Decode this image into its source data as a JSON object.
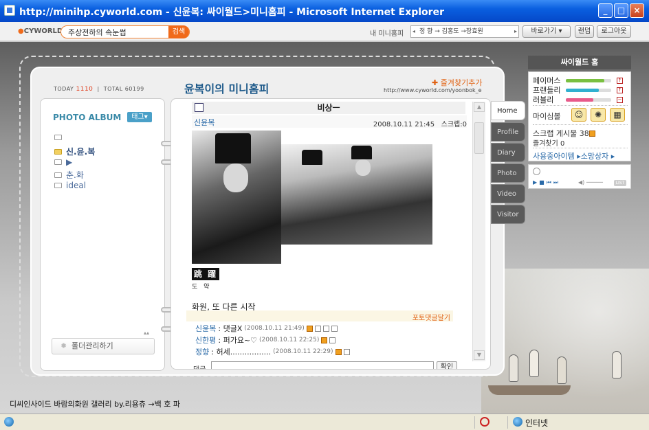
{
  "window": {
    "title": "http://minihp.cyworld.com - 신윤복: 싸이월드>미니홈피 - Microsoft Internet Explorer",
    "buttons": [
      "_",
      "□",
      "×"
    ]
  },
  "toolbar": {
    "logo": "CYWORLD",
    "search_value": "주상전하의 속눈썹",
    "search_button": "검색",
    "my_minihompy": "내 미니홈피",
    "path_text": "정 향 → 김홍도 →장효원",
    "goto": "바로가기",
    "random": "랜덤",
    "logout": "로그아웃"
  },
  "header": {
    "today_label": "TODAY",
    "today_value": "1110",
    "total_label": "TOTAL",
    "total_value": "60199",
    "title": "윤복이의 미니홈피",
    "favorite": "즐겨찾기추가",
    "url": "http://www.cyworld.com/yoonbok_e"
  },
  "album": {
    "title": "PHOTO ALBUM",
    "tag_button": "태그",
    "folders": [
      "",
      "신.윤.복",
      "▶",
      "춘.화",
      "ideal"
    ],
    "manage": "폴더관리하기"
  },
  "post": {
    "title": "비상ㅡ",
    "author": "신윤복",
    "date": "2008.10.11 21:45",
    "scrap": "스크랩:0",
    "stamp": "跳 躍",
    "stamp_sub": "도 약",
    "caption": "화원, 또 다른 시작",
    "comment_link": "포토댓글달기",
    "comments": [
      {
        "who": "신윤복",
        "text": ": 댓글X",
        "when": "(2008.10.11 21:49)"
      },
      {
        "who": "신한평",
        "text": ": 퍼가요~♡",
        "when": "(2008.10.11 22:25)"
      },
      {
        "who": "정향",
        "text": ": 허세.................",
        "when": "(2008.10.11 22:29)"
      }
    ],
    "reply_label": "댓글",
    "reply_button": "확인"
  },
  "tabs": [
    "Home",
    "Profile",
    "Diary",
    "Photo",
    "Video",
    "Visitor"
  ],
  "sidebar": {
    "head": "싸이월드 홈",
    "stats": [
      {
        "name": "페이머스",
        "level": 0.85,
        "color": "#7ac040"
      },
      {
        "name": "프랜들리",
        "level": 0.72,
        "color": "#30b0d0"
      },
      {
        "name": "러블리",
        "level": 0.6,
        "color": "#e85a8a"
      }
    ],
    "mood_label": "마이심볼",
    "scrap_label": "스크랩 게시물",
    "scrap_count": "38",
    "fav_label": "즐겨찾기",
    "fav_count": "0",
    "items_link": "사용중아이템 ▸소망상자 ▸"
  },
  "footer": {
    "text": "디씨인사이드 바람의화원 갤러리 by.리용츄 →백 호 파"
  },
  "status": {
    "zone": "인터넷"
  }
}
